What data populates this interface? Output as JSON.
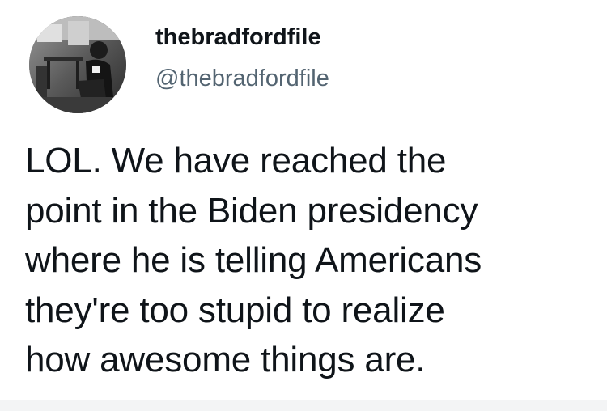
{
  "author": {
    "display_name": "thebradfordfile",
    "handle": "@thebradfordfile",
    "avatar_icon": "profile-photo-icon"
  },
  "tweet": {
    "lines": [
      "LOL. We have reached the",
      "point in the Biden presidency",
      "where he is telling Americans",
      "they're too stupid to realize",
      "how awesome things are."
    ]
  },
  "colors": {
    "text_primary": "#0f1419",
    "text_secondary": "#536471",
    "background": "#ffffff"
  }
}
